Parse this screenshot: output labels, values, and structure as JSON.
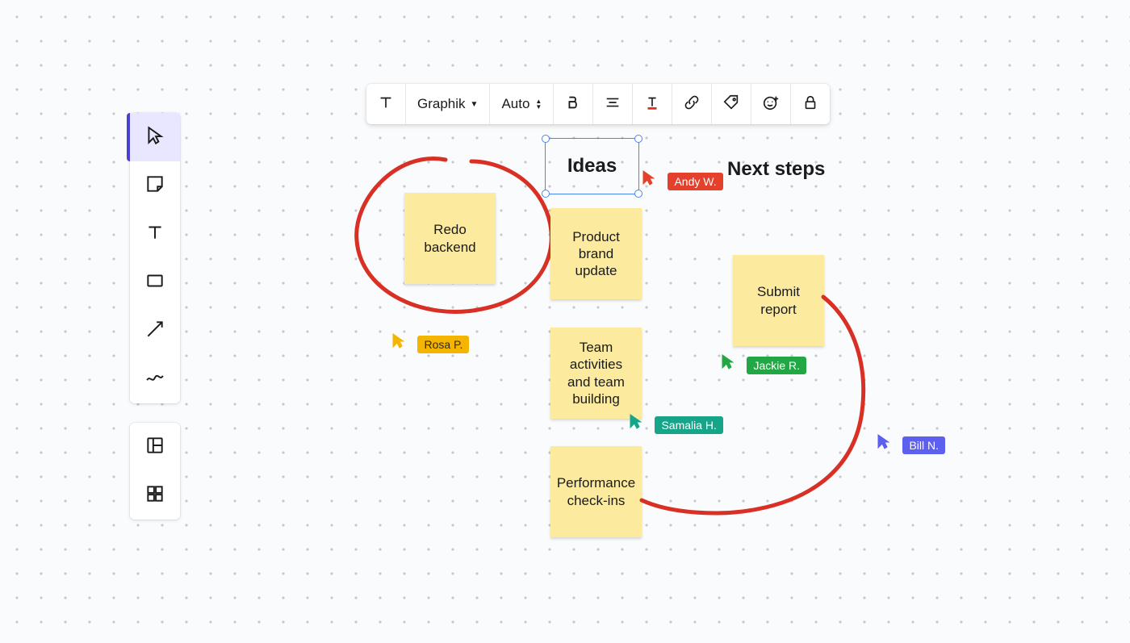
{
  "toolbar_vertical": {
    "tools": [
      {
        "name": "pointer-tool",
        "icon": "pointer",
        "active": true
      },
      {
        "name": "sticky-tool",
        "icon": "sticky",
        "active": false
      },
      {
        "name": "text-tool",
        "icon": "text",
        "active": false
      },
      {
        "name": "shape-tool",
        "icon": "rect",
        "active": false
      },
      {
        "name": "line-tool",
        "icon": "line",
        "active": false
      },
      {
        "name": "draw-tool",
        "icon": "scribble",
        "active": false
      }
    ],
    "secondary": [
      {
        "name": "layout-tool",
        "icon": "layout"
      },
      {
        "name": "grid-tool",
        "icon": "grid4"
      }
    ]
  },
  "context_toolbar": {
    "font_family": "Graphik",
    "font_size": "Auto"
  },
  "canvas": {
    "selected_text": "Ideas",
    "heading_next": "Next steps",
    "stickies": {
      "redo": "Redo backend",
      "brand": "Product brand update",
      "team": "Team activities and team building",
      "perf": "Performance check-ins",
      "submit": "Submit report"
    }
  },
  "collaborators": {
    "andy": {
      "label": "Andy W.",
      "color": "#e5402b"
    },
    "rosa": {
      "label": "Rosa P.",
      "color": "#f4b400"
    },
    "jackie": {
      "label": "Jackie R.",
      "color": "#21a743"
    },
    "samalia": {
      "label": "Samalia H.",
      "color": "#17a589"
    },
    "bill": {
      "label": "Bill N.",
      "color": "#5d5fef"
    }
  }
}
